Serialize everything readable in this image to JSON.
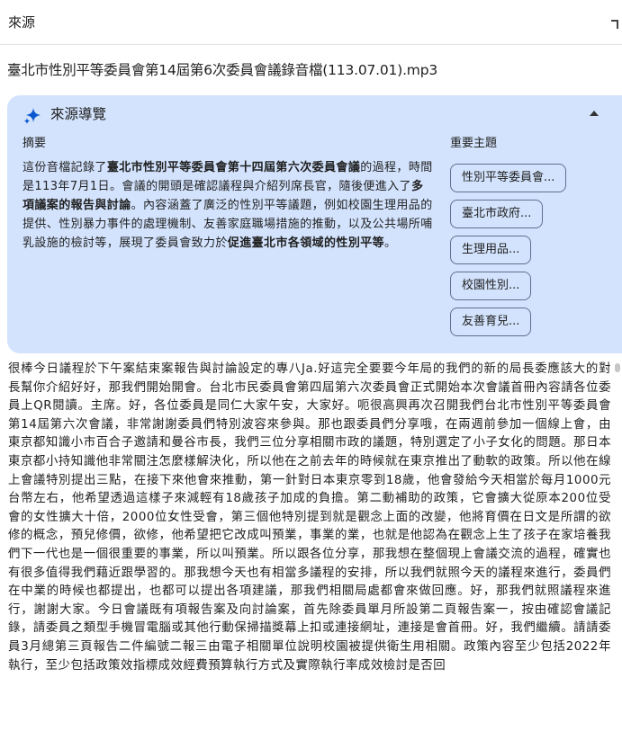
{
  "header": {
    "title": "來源"
  },
  "file": {
    "title": "臺北市性別平等委員會第14屆第6次委員會議錄音檔(113.07.01).mp3"
  },
  "guide": {
    "title": "來源導覽",
    "summary_heading": "摘要",
    "summary_parts": {
      "p1": "這份音檔記錄了",
      "b1": "臺北市性別平等委員會第十四屆第六次委員會議",
      "p2": "的過程，時間是113年7月1日。會議的開頭是確認議程與介紹列席長官，隨後便進入了",
      "b2": "多項議案的報告與討論",
      "p3": "。內容涵蓋了廣泛的性別平等議題，例如校園生理用品的提供、性別暴力事件的處理機制、友善家庭職場措施的推動，以及公共場所哺乳設施的檢討等，展現了委員會致力於",
      "b3": "促進臺北市各領域的性別平等",
      "p4": "。"
    },
    "topics_heading": "重要主題",
    "topics": [
      "性別平等委員會...",
      "臺北市政府...",
      "生理用品...",
      "校園性別...",
      "友善育兒..."
    ]
  },
  "transcript": "很棒今日議程於下午案結束案報告與討論設定的專八Ja.好這完全要要今年局的我們的新的局長委應該大的對長幫你介紹好好，那我們開始開會。台北市民委員會第四屆第六次委員會正式開始本次會議首冊內容請各位委員上QR閱讀。主席。好，各位委員是同仁大家午安，大家好。呃很高興再次召開我們台北市性別平等委員會第14屆第六次會議，非常謝謝委員們特別波容來參與。那也跟委員們分享哦，在兩週前參加一個線上會，由東京都知識小市百合子邀請和曼谷市長，我們三位分享相關市政的議題，特別選定了小子女化的問題。那日本東京都小持知識他非常關注怎麼樣解決化，所以他在之前去年的時候就在東京推出了動軟的政策。所以他在線上會議特別提出三點，在接下來他會來推動，第一針對日本東京零到18歲，他會發給今天相當於每月1000元台幣左右，他希望透過這樣子來減輕有18歲孩子加成的負擔。第二動補助的政策，它會擴大從原本200位受會的女性擴大十倍，2000位女性受會，第三個他特別提到就是觀念上面的改變，他將育價在日文是所謂的欲修的概念，預兒修價，欲修，他希望把它改成叫預業，事業的業，也就是他認為在觀念上生了孩子在家培養我們下一代也是一個很重要的事業，所以叫預業。所以跟各位分享，那我想在整個現上會議交流的過程，確實也有很多值得我們藉近跟學習的。那我想今天也有相當多議程的安排，所以我們就照今天的議程來進行，委員們在中業的時候也都提出，也都可以提出各項建議，那我們相關局處都會來做回應。好，那我們就照議程來進行，謝謝大家。今日會議既有項報告案及向討論案，首先除委員單月所設第二頁報告案一，按由確認會議記錄，請委員之類型手機冒電腦或其他行動保掃描獎幕上扣或連接網址，連接是會首冊。好，我們繼續。請請委員3月總第三頁報告二件編號二報三由電子相關單位說明校園被提供衛生用相關。政策內容至少包括2022年執行，至少包括政策效指標成效經費預算執行方式及實際執行率成效檢討是否回"
}
